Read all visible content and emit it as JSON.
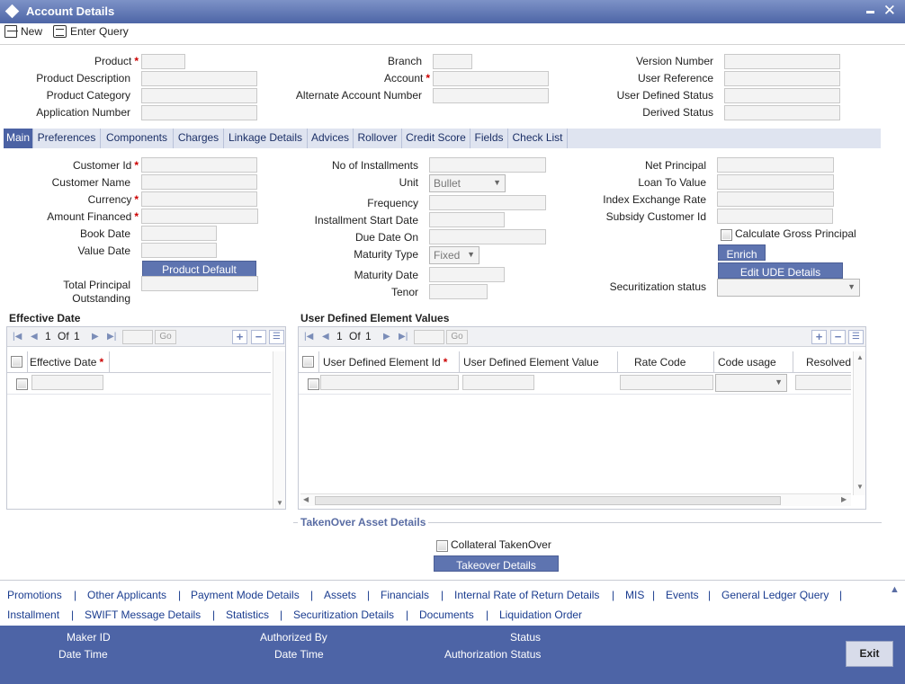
{
  "window": {
    "title": "Account Details"
  },
  "toolbar": {
    "new_label": "New",
    "enter_query_label": "Enter Query"
  },
  "header": {
    "product": "Product",
    "product_description": "Product Description",
    "product_category": "Product Category",
    "application_number": "Application Number",
    "branch": "Branch",
    "account": "Account",
    "alternate_account_number": "Alternate Account Number",
    "version_number": "Version Number",
    "user_reference": "User Reference",
    "user_defined_status": "User Defined Status",
    "derived_status": "Derived Status"
  },
  "tabs": [
    "Main",
    "Preferences",
    "Components",
    "Charges",
    "Linkage Details",
    "Advices",
    "Rollover",
    "Credit Score",
    "Fields",
    "Check List"
  ],
  "main": {
    "customer_id": "Customer Id",
    "customer_name": "Customer Name",
    "currency": "Currency",
    "amount_financed": "Amount Financed",
    "book_date": "Book Date",
    "value_date": "Value Date",
    "product_default": "Product Default",
    "total_principal_1": "Total Principal",
    "total_principal_2": "Outstanding",
    "no_of_installments": "No of Installments",
    "unit": "Unit",
    "unit_value": "Bullet",
    "frequency": "Frequency",
    "installment_start_date": "Installment Start Date",
    "due_date_on": "Due Date On",
    "maturity_type": "Maturity Type",
    "maturity_type_value": "Fixed",
    "maturity_date": "Maturity Date",
    "tenor": "Tenor",
    "net_principal": "Net Principal",
    "loan_to_value": "Loan To Value",
    "index_exchange_rate": "Index Exchange Rate",
    "subsidy_customer_id": "Subsidy Customer Id",
    "calculate_gross_principal": "Calculate Gross Principal",
    "enrich": "Enrich",
    "edit_ude_details": "Edit UDE Details",
    "securitization_status": "Securitization status",
    "required_mark": "*"
  },
  "effective_date": {
    "title": "Effective Date",
    "page": "1",
    "of": "Of",
    "total": "1",
    "go": "Go",
    "col_effective_date": "Effective Date"
  },
  "ude": {
    "title": "User Defined Element Values",
    "page": "1",
    "of": "Of",
    "total": "1",
    "go": "Go",
    "col_ude_id": "User Defined Element Id",
    "col_ude_value": "User Defined Element Value",
    "col_rate_code": "Rate Code",
    "col_code_usage": "Code usage",
    "col_resolved": "Resolved"
  },
  "takeover": {
    "title": "TakenOver Asset Details",
    "collateral": "Collateral TakenOver",
    "button": "Takeover Details"
  },
  "links": {
    "row1": [
      "Promotions",
      "Other Applicants",
      "Payment Mode Details",
      "Assets",
      "Financials",
      "Internal Rate of Return Details",
      "MIS",
      "Events",
      "General Ledger Query"
    ],
    "row2": [
      "Installment",
      "SWIFT Message Details",
      "Statistics",
      "Securitization Details",
      "Documents",
      "Liquidation Order"
    ],
    "separator": "|"
  },
  "audit": {
    "maker_id": "Maker ID",
    "date_time_1": "Date Time",
    "authorized_by": "Authorized By",
    "date_time_2": "Date Time",
    "status": "Status",
    "authorization_status": "Authorization Status",
    "exit": "Exit"
  }
}
